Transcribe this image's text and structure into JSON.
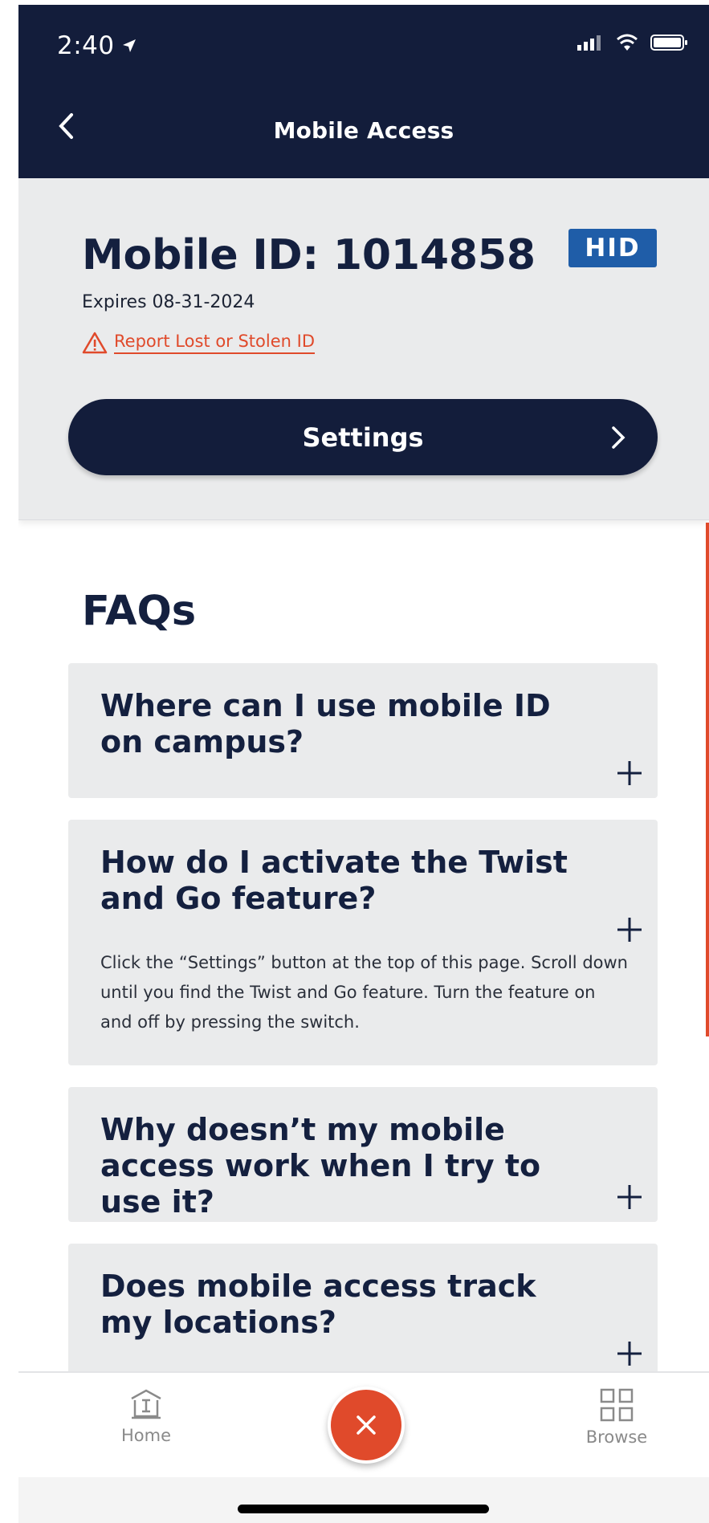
{
  "status_bar": {
    "time": "2:40"
  },
  "nav": {
    "title": "Mobile Access"
  },
  "id_card": {
    "title": "Mobile ID: 1014858",
    "logo": "HID",
    "expires": "Expires 08-31-2024",
    "report_link": "Report Lost or Stolen ID",
    "settings_label": "Settings"
  },
  "faqs": {
    "title": "FAQs",
    "items": [
      {
        "question": "Where can I use mobile ID on campus?",
        "answer": ""
      },
      {
        "question": "How do I activate the Twist and Go feature?",
        "answer": "Click the “Settings” button at the top of this page. Scroll down until you find the Twist and Go feature. Turn the feature on and off by pressing the switch."
      },
      {
        "question": "Why doesn’t my mobile access work when I try to use it?",
        "answer": ""
      },
      {
        "question": "Does mobile access track my locations?",
        "answer": ""
      }
    ]
  },
  "tabbar": {
    "home_label": "Home",
    "browse_label": "Browse"
  },
  "colors": {
    "navy": "#131d3b",
    "accent": "#e04a2b",
    "panel": "#eaebec",
    "hid_blue": "#1f5da8"
  }
}
